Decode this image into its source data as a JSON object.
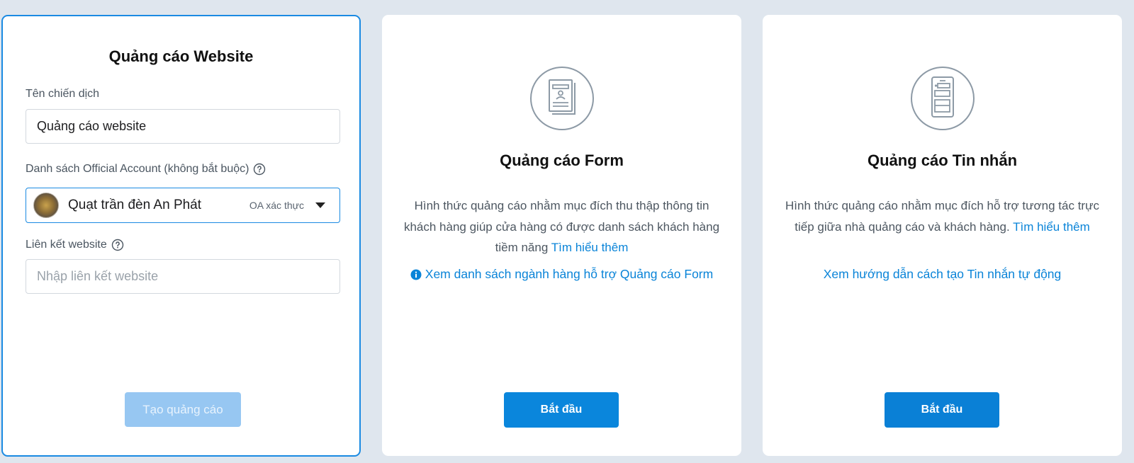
{
  "website_card": {
    "title": "Quảng cáo Website",
    "campaign_label": "Tên chiến dịch",
    "campaign_value": "Quảng cáo website",
    "oa_label": "Danh sách Official Account (không bắt buộc)",
    "oa_selected_name": "Quạt trần đèn An Phát",
    "oa_selected_badge": "OA xác thực",
    "link_label": "Liên kết website",
    "link_placeholder": "Nhập liên kết website",
    "create_button": "Tạo quảng cáo"
  },
  "form_card": {
    "icon": "form-document-icon",
    "title": "Quảng cáo Form",
    "description": "Hình thức quảng cáo nhằm mục đích thu thập thông tin khách hàng giúp cửa hàng có được danh sách khách hàng tiềm năng",
    "learn_more": "Tìm hiểu thêm",
    "support_link": "Xem danh sách ngành hàng hỗ trợ Quảng cáo Form",
    "start_button": "Bắt đầu"
  },
  "message_card": {
    "icon": "phone-message-icon",
    "title": "Quảng cáo Tin nhắn",
    "description": "Hình thức quảng cáo nhằm mục đích hỗ trợ tương tác trực tiếp giữa nhà quảng cáo và khách hàng.",
    "learn_more": "Tìm hiểu thêm",
    "guide_link": "Xem hướng dẫn cách tạo Tin nhắn tự động",
    "start_button": "Bắt đầu"
  },
  "colors": {
    "accent": "#0a86dc",
    "link": "#0a84d8",
    "disabled_button": "#97c7f2",
    "background": "#dfe6ee"
  }
}
